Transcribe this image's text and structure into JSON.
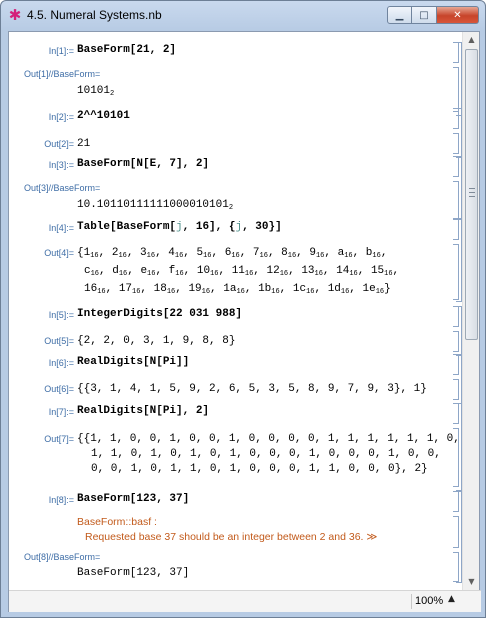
{
  "window": {
    "title": "4.5. Numeral Systems.nb",
    "app_icon": "✱"
  },
  "cells": {
    "in1": {
      "label": "In[1]:=",
      "code": "BaseForm[21, 2]"
    },
    "out1": {
      "label": "Out[1]//BaseForm=",
      "value": "10101",
      "sub": "2"
    },
    "in2": {
      "label": "In[2]:=",
      "code": "2^^10101"
    },
    "out2": {
      "label": "Out[2]=",
      "value": "21"
    },
    "in3": {
      "label": "In[3]:=",
      "code": "BaseForm[N[E, 7], 2]"
    },
    "out3": {
      "label": "Out[3]//BaseForm=",
      "value": "10.10110111111000010101",
      "sub": "2"
    },
    "in4": {
      "label": "In[4]:=",
      "code_a": "Table[BaseForm[",
      "var1": "j",
      "code_b": ", 16], {",
      "var2": "j",
      "code_c": ", 30}]"
    },
    "out4": {
      "label": "Out[4]=",
      "open": "{",
      "close": "}",
      "lines": [
        [
          {
            "v": "1",
            "s": "16"
          },
          {
            "v": "2",
            "s": "16"
          },
          {
            "v": "3",
            "s": "16"
          },
          {
            "v": "4",
            "s": "16"
          },
          {
            "v": "5",
            "s": "16"
          },
          {
            "v": "6",
            "s": "16"
          },
          {
            "v": "7",
            "s": "16"
          },
          {
            "v": "8",
            "s": "16"
          },
          {
            "v": "9",
            "s": "16"
          },
          {
            "v": "a",
            "s": "16"
          },
          {
            "v": "b",
            "s": "16"
          }
        ],
        [
          {
            "v": "c",
            "s": "16"
          },
          {
            "v": "d",
            "s": "16"
          },
          {
            "v": "e",
            "s": "16"
          },
          {
            "v": "f",
            "s": "16"
          },
          {
            "v": "10",
            "s": "16"
          },
          {
            "v": "11",
            "s": "16"
          },
          {
            "v": "12",
            "s": "16"
          },
          {
            "v": "13",
            "s": "16"
          },
          {
            "v": "14",
            "s": "16"
          },
          {
            "v": "15",
            "s": "16"
          }
        ],
        [
          {
            "v": "16",
            "s": "16"
          },
          {
            "v": "17",
            "s": "16"
          },
          {
            "v": "18",
            "s": "16"
          },
          {
            "v": "19",
            "s": "16"
          },
          {
            "v": "1a",
            "s": "16"
          },
          {
            "v": "1b",
            "s": "16"
          },
          {
            "v": "1c",
            "s": "16"
          },
          {
            "v": "1d",
            "s": "16"
          },
          {
            "v": "1e",
            "s": "16"
          }
        ]
      ]
    },
    "in5": {
      "label": "In[5]:=",
      "code": "IntegerDigits[22 031 988]"
    },
    "out5": {
      "label": "Out[5]=",
      "value": "{2, 2, 0, 3, 1, 9, 8, 8}"
    },
    "in6": {
      "label": "In[6]:=",
      "code": "RealDigits[N[Pi]]"
    },
    "out6": {
      "label": "Out[6]=",
      "value": "{{3, 1, 4, 1, 5, 9, 2, 6, 5, 3, 5, 8, 9, 7, 9, 3}, 1}"
    },
    "in7": {
      "label": "In[7]:=",
      "code": "RealDigits[N[Pi], 2]"
    },
    "out7": {
      "label": "Out[7]=",
      "line1": "{{1, 1, 0, 0, 1, 0, 0, 1, 0, 0, 0, 0, 1, 1, 1, 1, 1, 1, 0,",
      "line2": "1, 1, 0, 1, 0, 1, 0, 1, 0, 0, 0, 1, 0, 0, 0, 1, 0, 0,",
      "line3": "0, 0, 1, 0, 1, 1, 0, 1, 0, 0, 0, 1, 1, 0, 0, 0}, 2}"
    },
    "in8": {
      "label": "In[8]:=",
      "code": "BaseForm[123, 37]"
    },
    "msg8": {
      "tag": "BaseForm::basf :",
      "text": "Requested base 37 should be an integer between 2 and 36.",
      "link": "≫"
    },
    "out8": {
      "label": "Out[8]//BaseForm=",
      "value": "BaseForm[123, 37]"
    }
  },
  "status": {
    "zoom": "100%",
    "zoom_arrow": "▲"
  },
  "scrollbar": {
    "up": "▲",
    "down": "▼"
  },
  "colors": {
    "label": "#3e6da6",
    "warning": "#c25a1b",
    "bracket": "#8ea6c7",
    "variable": "#4d8f8a"
  }
}
